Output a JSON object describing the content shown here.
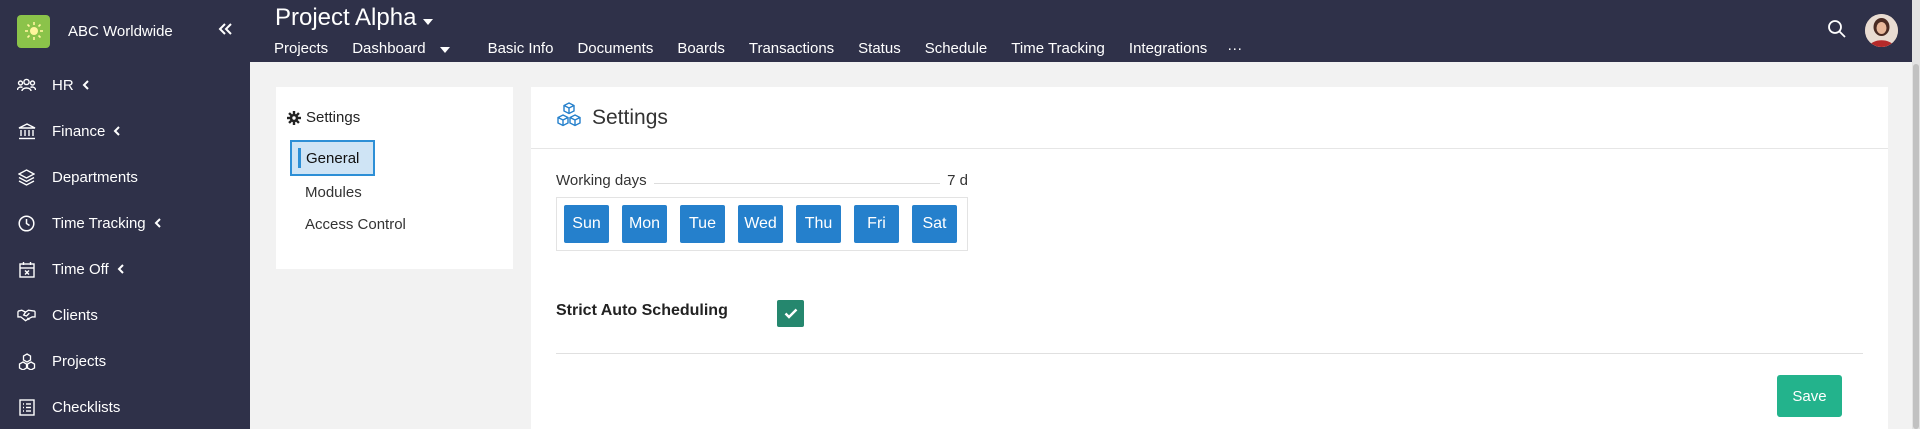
{
  "brand": {
    "name": "ABC Worldwide",
    "logo_icon": "sun-icon",
    "logo_color": "#8bc34a"
  },
  "sidebar": {
    "items": [
      {
        "label": "HR",
        "icon": "people-icon",
        "has_caret": true
      },
      {
        "label": "Finance",
        "icon": "bank-icon",
        "has_caret": true
      },
      {
        "label": "Departments",
        "icon": "layers-icon",
        "has_caret": false
      },
      {
        "label": "Time Tracking",
        "icon": "clock-icon",
        "has_caret": true
      },
      {
        "label": "Time Off",
        "icon": "calendar-x-icon",
        "has_caret": true
      },
      {
        "label": "Clients",
        "icon": "handshake-icon",
        "has_caret": false
      },
      {
        "label": "Projects",
        "icon": "cubes-icon",
        "has_caret": false
      },
      {
        "label": "Checklists",
        "icon": "checklist-icon",
        "has_caret": false
      }
    ]
  },
  "header": {
    "project_title": "Project Alpha",
    "tabs": [
      {
        "label": "Projects"
      },
      {
        "label": "Dashboard"
      },
      {
        "label": "Basic Info"
      },
      {
        "label": "Documents"
      },
      {
        "label": "Boards"
      },
      {
        "label": "Transactions"
      },
      {
        "label": "Status"
      },
      {
        "label": "Schedule"
      },
      {
        "label": "Time Tracking"
      },
      {
        "label": "Integrations"
      }
    ],
    "more_label": "···"
  },
  "settings_nav": {
    "title": "Settings",
    "items": [
      {
        "label": "General",
        "active": true
      },
      {
        "label": "Modules",
        "active": false
      },
      {
        "label": "Access Control",
        "active": false
      }
    ]
  },
  "main": {
    "title": "Settings",
    "working_days_label": "Working days",
    "working_days_value": "7 d",
    "days": [
      "Sun",
      "Mon",
      "Tue",
      "Wed",
      "Thu",
      "Fri",
      "Sat"
    ],
    "strict_label": "Strict Auto Scheduling",
    "strict_checked": true,
    "save_label": "Save"
  },
  "colors": {
    "sidebar_bg": "#2f3149",
    "day_button": "#2580cc",
    "active_nav_bg": "#cfe4f5",
    "active_nav_border": "#2d8fd6",
    "checkbox": "#25876e",
    "save_button": "#23b38c"
  }
}
